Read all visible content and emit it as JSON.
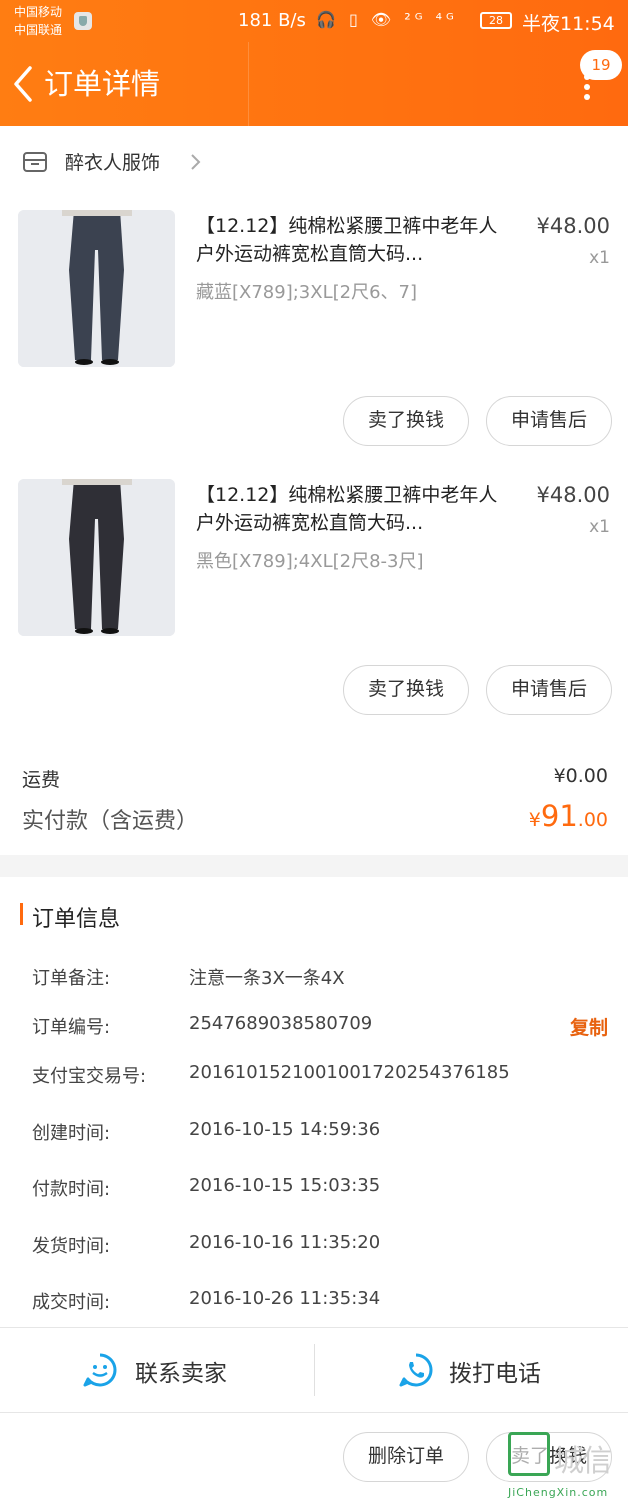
{
  "status_bar": {
    "carrier_1": "中国移动",
    "carrier_2": "中国联通",
    "net_speed": "181 B/s",
    "signal_icons": "🎧 ▯ 👁 ²ᴳ ⁴ᴳ",
    "battery": "28",
    "time": "半夜11:54"
  },
  "nav": {
    "title": "订单详情",
    "badge_count": "19"
  },
  "shop": {
    "name": "醉衣人服饰"
  },
  "items": [
    {
      "title": "【12.12】纯棉松紧腰卫裤中老年人户外运动裤宽松直筒大码...",
      "price": "¥48.00",
      "qty": "x1",
      "sku": "藏蓝[X789];3XL[2尺6、7]",
      "sell_label": "卖了换钱",
      "after_sale_label": "申请售后",
      "pants_color": "#3b4250"
    },
    {
      "title": "【12.12】纯棉松紧腰卫裤中老年人户外运动裤宽松直筒大码...",
      "price": "¥48.00",
      "qty": "x1",
      "sku": "黑色[X789];4XL[2尺8-3尺]",
      "sell_label": "卖了换钱",
      "after_sale_label": "申请售后",
      "pants_color": "#2f2f36"
    }
  ],
  "fees": {
    "shipping_label": "运费",
    "shipping_value": "¥0.00",
    "paid_label": "实付款（含运费）",
    "paid_yen": "¥",
    "paid_int": "91",
    "paid_dec": ".00"
  },
  "order_info": {
    "section_title": "订单信息",
    "rows": [
      {
        "label": "订单备注:",
        "value": "注意一条3X一条4X"
      },
      {
        "label": "订单编号:",
        "value": "2547689038580709"
      },
      {
        "label": "支付宝交易号:",
        "value": "2016101521001001720254376185"
      },
      {
        "label": "创建时间:",
        "value": "2016-10-15 14:59:36"
      },
      {
        "label": "付款时间:",
        "value": "2016-10-15 15:03:35"
      },
      {
        "label": "发货时间:",
        "value": "2016-10-16 11:35:20"
      },
      {
        "label": "成交时间:",
        "value": "2016-10-26 11:35:34"
      }
    ],
    "copy_label": "复制"
  },
  "actions": {
    "contact_seller": "联系卖家",
    "call_phone": "拨打电话"
  },
  "bottom_buttons": {
    "delete_order": "删除订单",
    "sell": "卖了换钱"
  },
  "watermark": {
    "text": "城信",
    "sub": "JiChengXin.com"
  },
  "colors": {
    "accent": "#ff6a0f",
    "icon_blue": "#1aa3e8"
  }
}
